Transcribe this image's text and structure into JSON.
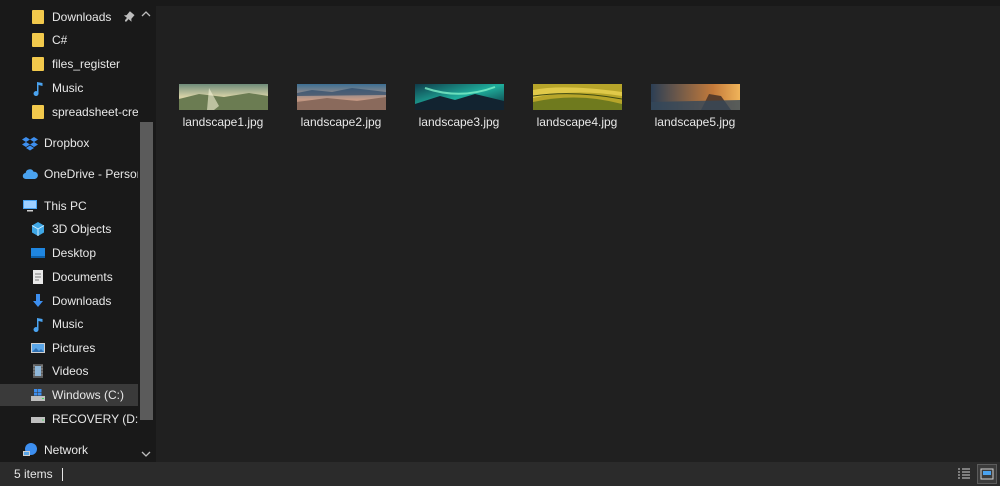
{
  "nav": {
    "quick_access": [
      {
        "label": "Downloads"
      },
      {
        "label": "C#"
      },
      {
        "label": "files_register"
      },
      {
        "label": "Music"
      },
      {
        "label": "spreadsheet-creator"
      }
    ],
    "dropbox": "Dropbox",
    "onedrive": "OneDrive - Personal",
    "this_pc": "This PC",
    "pc_items": [
      {
        "label": "3D Objects"
      },
      {
        "label": "Desktop"
      },
      {
        "label": "Documents"
      },
      {
        "label": "Downloads"
      },
      {
        "label": "Music"
      },
      {
        "label": "Pictures"
      },
      {
        "label": "Videos"
      },
      {
        "label": "Windows (C:)"
      },
      {
        "label": "RECOVERY (D:)"
      }
    ],
    "network": "Network"
  },
  "files": [
    {
      "name": "landscape1.jpg"
    },
    {
      "name": "landscape2.jpg"
    },
    {
      "name": "landscape3.jpg"
    },
    {
      "name": "landscape4.jpg"
    },
    {
      "name": "landscape5.jpg"
    }
  ],
  "status": {
    "item_count": "5 items"
  },
  "colors": {
    "folder": "#f2c94c",
    "accent": "#4aa3f0",
    "background": "#202020",
    "sidebar": "#191919"
  }
}
